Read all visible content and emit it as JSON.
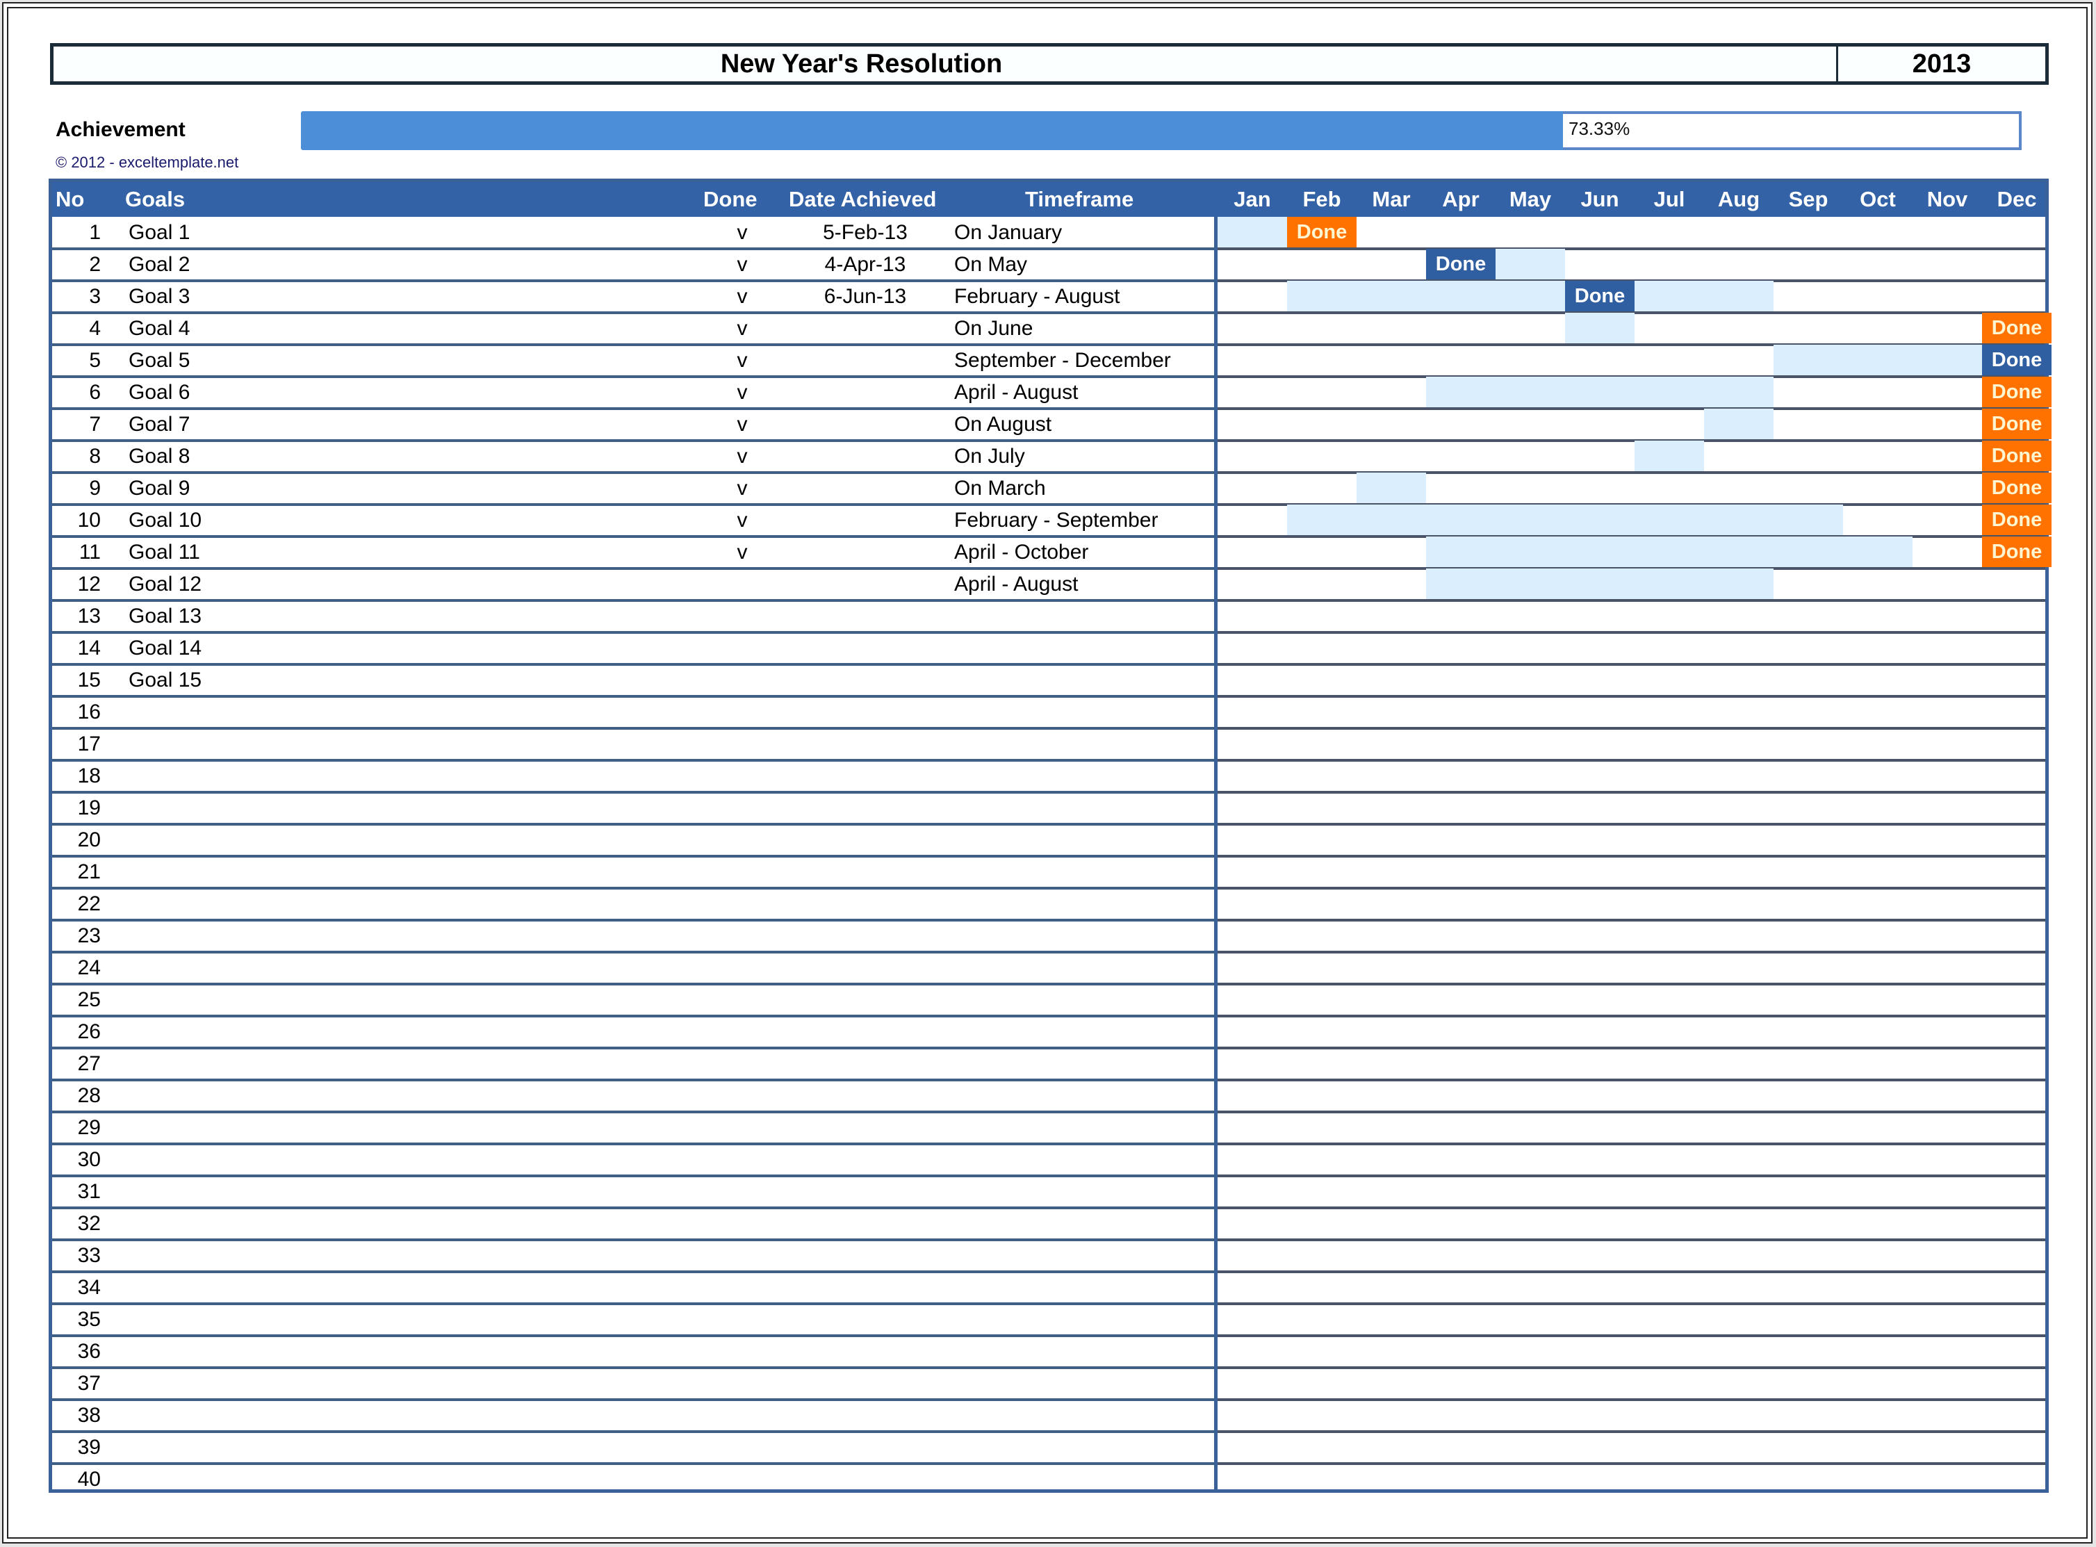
{
  "header": {
    "title": "New Year's Resolution",
    "year": "2013"
  },
  "achievement": {
    "label": "Achievement",
    "percent_text": "73.33%",
    "progress_fraction": 0.7333,
    "copyright": "© 2012 - exceltemplate.net"
  },
  "colors": {
    "header_blue": "#3462a6",
    "progress_fill": "#4d8ed8",
    "timeframe_light": "#daeefe",
    "done_orange": "#ff7200",
    "done_dark_blue": "#2f5fa0"
  },
  "table": {
    "columns": {
      "no": "No",
      "goals": "Goals",
      "done": "Done",
      "date": "Date Achieved",
      "timeframe": "Timeframe"
    },
    "months": [
      "Jan",
      "Feb",
      "Mar",
      "Apr",
      "May",
      "Jun",
      "Jul",
      "Aug",
      "Sep",
      "Oct",
      "Nov",
      "Dec"
    ],
    "done_label": "Done",
    "rows": [
      {
        "no": "1",
        "goal": "Goal 1",
        "done": "v",
        "date": "5-Feb-13",
        "timeframe": "On January",
        "plan": [
          0,
          0
        ],
        "done_month": 1,
        "done_style": "orange"
      },
      {
        "no": "2",
        "goal": "Goal 2",
        "done": "v",
        "date": "4-Apr-13",
        "timeframe": "On May",
        "plan": [
          4,
          4
        ],
        "done_month": 3,
        "done_style": "dark"
      },
      {
        "no": "3",
        "goal": "Goal 3",
        "done": "v",
        "date": "6-Jun-13",
        "timeframe": "February - August",
        "plan": [
          1,
          7
        ],
        "done_month": 5,
        "done_style": "dark"
      },
      {
        "no": "4",
        "goal": "Goal 4",
        "done": "v",
        "date": "",
        "timeframe": "On June",
        "plan": [
          5,
          5
        ],
        "done_month": 11,
        "done_style": "orange"
      },
      {
        "no": "5",
        "goal": "Goal 5",
        "done": "v",
        "date": "",
        "timeframe": "September - December",
        "plan": [
          8,
          11
        ],
        "done_month": 11,
        "done_style": "dark"
      },
      {
        "no": "6",
        "goal": "Goal 6",
        "done": "v",
        "date": "",
        "timeframe": "April - August",
        "plan": [
          3,
          7
        ],
        "done_month": 11,
        "done_style": "orange"
      },
      {
        "no": "7",
        "goal": "Goal 7",
        "done": "v",
        "date": "",
        "timeframe": "On August",
        "plan": [
          7,
          7
        ],
        "done_month": 11,
        "done_style": "orange"
      },
      {
        "no": "8",
        "goal": "Goal 8",
        "done": "v",
        "date": "",
        "timeframe": "On July",
        "plan": [
          6,
          6
        ],
        "done_month": 11,
        "done_style": "orange"
      },
      {
        "no": "9",
        "goal": "Goal 9",
        "done": "v",
        "date": "",
        "timeframe": "On March",
        "plan": [
          2,
          2
        ],
        "done_month": 11,
        "done_style": "orange"
      },
      {
        "no": "10",
        "goal": "Goal 10",
        "done": "v",
        "date": "",
        "timeframe": "February - September",
        "plan": [
          1,
          8
        ],
        "done_month": 11,
        "done_style": "orange"
      },
      {
        "no": "11",
        "goal": "Goal 11",
        "done": "v",
        "date": "",
        "timeframe": "April - October",
        "plan": [
          3,
          9
        ],
        "done_month": 11,
        "done_style": "orange"
      },
      {
        "no": "12",
        "goal": "Goal 12",
        "done": "",
        "date": "",
        "timeframe": "April - August",
        "plan": [
          3,
          7
        ],
        "done_month": null,
        "done_style": null
      },
      {
        "no": "13",
        "goal": "Goal 13",
        "done": "",
        "date": "",
        "timeframe": "",
        "plan": null,
        "done_month": null,
        "done_style": null
      },
      {
        "no": "14",
        "goal": "Goal 14",
        "done": "",
        "date": "",
        "timeframe": "",
        "plan": null,
        "done_month": null,
        "done_style": null
      },
      {
        "no": "15",
        "goal": "Goal 15",
        "done": "",
        "date": "",
        "timeframe": "",
        "plan": null,
        "done_month": null,
        "done_style": null
      },
      {
        "no": "16",
        "goal": "",
        "done": "",
        "date": "",
        "timeframe": "",
        "plan": null,
        "done_month": null,
        "done_style": null
      },
      {
        "no": "17",
        "goal": "",
        "done": "",
        "date": "",
        "timeframe": "",
        "plan": null,
        "done_month": null,
        "done_style": null
      },
      {
        "no": "18",
        "goal": "",
        "done": "",
        "date": "",
        "timeframe": "",
        "plan": null,
        "done_month": null,
        "done_style": null
      },
      {
        "no": "19",
        "goal": "",
        "done": "",
        "date": "",
        "timeframe": "",
        "plan": null,
        "done_month": null,
        "done_style": null
      },
      {
        "no": "20",
        "goal": "",
        "done": "",
        "date": "",
        "timeframe": "",
        "plan": null,
        "done_month": null,
        "done_style": null
      },
      {
        "no": "21",
        "goal": "",
        "done": "",
        "date": "",
        "timeframe": "",
        "plan": null,
        "done_month": null,
        "done_style": null
      },
      {
        "no": "22",
        "goal": "",
        "done": "",
        "date": "",
        "timeframe": "",
        "plan": null,
        "done_month": null,
        "done_style": null
      },
      {
        "no": "23",
        "goal": "",
        "done": "",
        "date": "",
        "timeframe": "",
        "plan": null,
        "done_month": null,
        "done_style": null
      },
      {
        "no": "24",
        "goal": "",
        "done": "",
        "date": "",
        "timeframe": "",
        "plan": null,
        "done_month": null,
        "done_style": null
      },
      {
        "no": "25",
        "goal": "",
        "done": "",
        "date": "",
        "timeframe": "",
        "plan": null,
        "done_month": null,
        "done_style": null
      },
      {
        "no": "26",
        "goal": "",
        "done": "",
        "date": "",
        "timeframe": "",
        "plan": null,
        "done_month": null,
        "done_style": null
      },
      {
        "no": "27",
        "goal": "",
        "done": "",
        "date": "",
        "timeframe": "",
        "plan": null,
        "done_month": null,
        "done_style": null
      },
      {
        "no": "28",
        "goal": "",
        "done": "",
        "date": "",
        "timeframe": "",
        "plan": null,
        "done_month": null,
        "done_style": null
      },
      {
        "no": "29",
        "goal": "",
        "done": "",
        "date": "",
        "timeframe": "",
        "plan": null,
        "done_month": null,
        "done_style": null
      },
      {
        "no": "30",
        "goal": "",
        "done": "",
        "date": "",
        "timeframe": "",
        "plan": null,
        "done_month": null,
        "done_style": null
      },
      {
        "no": "31",
        "goal": "",
        "done": "",
        "date": "",
        "timeframe": "",
        "plan": null,
        "done_month": null,
        "done_style": null
      },
      {
        "no": "32",
        "goal": "",
        "done": "",
        "date": "",
        "timeframe": "",
        "plan": null,
        "done_month": null,
        "done_style": null
      },
      {
        "no": "33",
        "goal": "",
        "done": "",
        "date": "",
        "timeframe": "",
        "plan": null,
        "done_month": null,
        "done_style": null
      },
      {
        "no": "34",
        "goal": "",
        "done": "",
        "date": "",
        "timeframe": "",
        "plan": null,
        "done_month": null,
        "done_style": null
      },
      {
        "no": "35",
        "goal": "",
        "done": "",
        "date": "",
        "timeframe": "",
        "plan": null,
        "done_month": null,
        "done_style": null
      },
      {
        "no": "36",
        "goal": "",
        "done": "",
        "date": "",
        "timeframe": "",
        "plan": null,
        "done_month": null,
        "done_style": null
      },
      {
        "no": "37",
        "goal": "",
        "done": "",
        "date": "",
        "timeframe": "",
        "plan": null,
        "done_month": null,
        "done_style": null
      },
      {
        "no": "38",
        "goal": "",
        "done": "",
        "date": "",
        "timeframe": "",
        "plan": null,
        "done_month": null,
        "done_style": null
      },
      {
        "no": "39",
        "goal": "",
        "done": "",
        "date": "",
        "timeframe": "",
        "plan": null,
        "done_month": null,
        "done_style": null
      },
      {
        "no": "40",
        "goal": "",
        "done": "",
        "date": "",
        "timeframe": "",
        "plan": null,
        "done_month": null,
        "done_style": null
      }
    ]
  }
}
